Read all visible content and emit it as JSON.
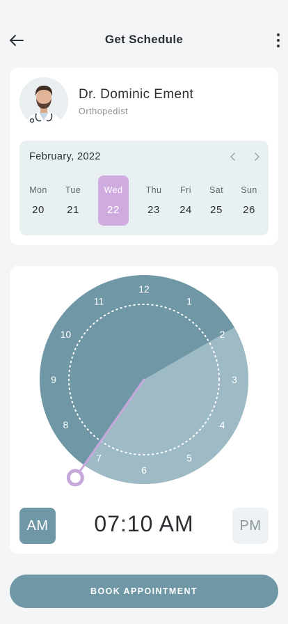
{
  "header": {
    "title": "Get Schedule",
    "back_icon": "arrow-left-icon",
    "more_icon": "more-vertical-icon"
  },
  "doctor": {
    "name": "Dr. Dominic Ement",
    "specialty": "Orthopedist"
  },
  "calendar": {
    "month": "February, 2022",
    "days": [
      {
        "name": "Mon",
        "num": "20"
      },
      {
        "name": "Tue",
        "num": "21"
      },
      {
        "name": "Wed",
        "num": "22"
      },
      {
        "name": "Thu",
        "num": "23"
      },
      {
        "name": "Fri",
        "num": "24"
      },
      {
        "name": "Sat",
        "num": "25"
      },
      {
        "name": "Sun",
        "num": "26"
      }
    ],
    "selected_index": 2
  },
  "clock": {
    "numbers": [
      "12",
      "1",
      "2",
      "3",
      "4",
      "5",
      "6",
      "7",
      "8",
      "9",
      "10",
      "11"
    ],
    "selected_hour": 7,
    "selected_minute": 10,
    "time_display": "07:10 AM",
    "am_label": "AM",
    "pm_label": "PM",
    "active_period": "AM"
  },
  "book_button": "BOOK APPOINTMENT",
  "colors": {
    "primary": "#6f97a6",
    "accent": "#cfabdf",
    "calendar_bg": "#e8f0f2"
  }
}
